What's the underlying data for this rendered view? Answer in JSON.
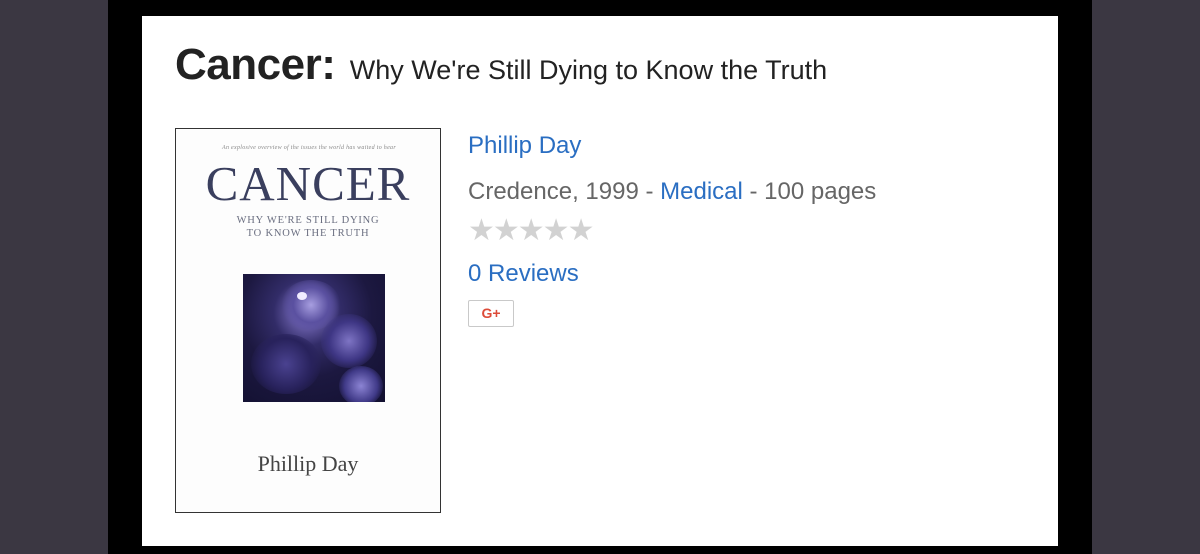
{
  "book": {
    "title_main": "Cancer:",
    "title_sub": "Why We're Still Dying to Know the Truth",
    "author": "Phillip Day",
    "publisher_year": "Credence, 1999 - ",
    "category": "Medical",
    "pages": " - 100 pages",
    "rating_stars": "★★★★★",
    "rating_value": 0,
    "rating_max": 5,
    "reviews": "0 Reviews",
    "share_button": "G+"
  },
  "cover": {
    "tagline": "An explosive overview of the issues the world has waited to hear",
    "word": "CANCER",
    "line1": "WHY WE'RE STILL DYING",
    "line2": "TO KNOW THE TRUTH",
    "author": "Phillip Day"
  },
  "colors": {
    "link": "#2a6ec2",
    "star_empty": "#d2d2d2",
    "google_red": "#dd4b39"
  }
}
